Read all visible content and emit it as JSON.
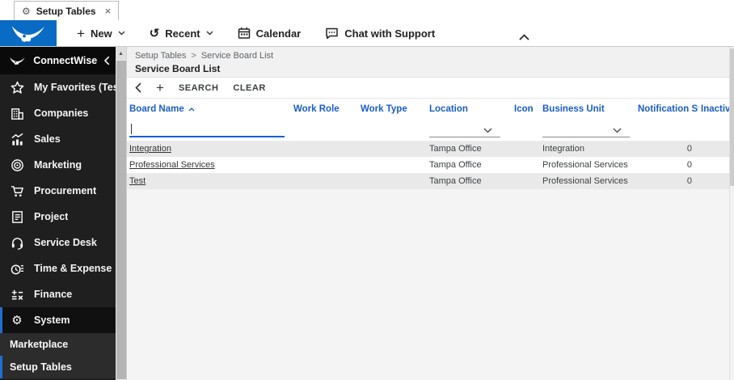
{
  "window": {
    "tab_title": "Setup Tables",
    "close_glyph": "×"
  },
  "toolbar": {
    "new_label": "New",
    "recent_label": "Recent",
    "calendar_label": "Calendar",
    "chat_label": "Chat with Support",
    "plus_glyph": "+",
    "recent_glyph": "↺"
  },
  "sidebar": {
    "brand_label": "ConnectWise",
    "items": [
      {
        "label": "My Favorites (Testing"
      },
      {
        "label": "Companies"
      },
      {
        "label": "Sales"
      },
      {
        "label": "Marketing"
      },
      {
        "label": "Procurement"
      },
      {
        "label": "Project"
      },
      {
        "label": "Service Desk"
      },
      {
        "label": "Time & Expense"
      },
      {
        "label": "Finance"
      },
      {
        "label": "System"
      }
    ],
    "subitems": [
      {
        "label": "Marketplace"
      },
      {
        "label": "Setup Tables"
      }
    ],
    "gear_glyph": "⚙",
    "scroll_up_glyph": "▲"
  },
  "page": {
    "breadcrumb": {
      "part1": "Setup Tables",
      "separator": ">",
      "part2": "Service Board List"
    },
    "title": "Service Board List",
    "search_label": "SEARCH",
    "clear_label": "CLEAR"
  },
  "table": {
    "columns": [
      "Board Name",
      "Work Role",
      "Work Type",
      "Location",
      "Icon",
      "Business Unit",
      "Notification Steps",
      "Inactive"
    ],
    "sorted_by": "Board Name",
    "rows": [
      {
        "board_name": "Integration",
        "work_role": "",
        "work_type": "",
        "location": "Tampa Office",
        "icon": "",
        "business_unit": "Integration",
        "notification_steps": "0",
        "inactive": ""
      },
      {
        "board_name": "Professional Services",
        "work_role": "",
        "work_type": "",
        "location": "Tampa Office",
        "icon": "",
        "business_unit": "Professional Services",
        "notification_steps": "0",
        "inactive": ""
      },
      {
        "board_name": "Test",
        "work_role": "",
        "work_type": "",
        "location": "Tampa Office",
        "icon": "",
        "business_unit": "Professional Services",
        "notification_steps": "0",
        "inactive": ""
      }
    ]
  },
  "colors": {
    "brand_blue": "#0a6bc4",
    "header_link_blue": "#1a5dc8",
    "filter_focus_blue": "#1a5ed8",
    "sidebar_bg": "#1f1f1f",
    "sidebar_active_accent": "#1f6fd0",
    "row_alt_gray": "#e9e9e9"
  }
}
